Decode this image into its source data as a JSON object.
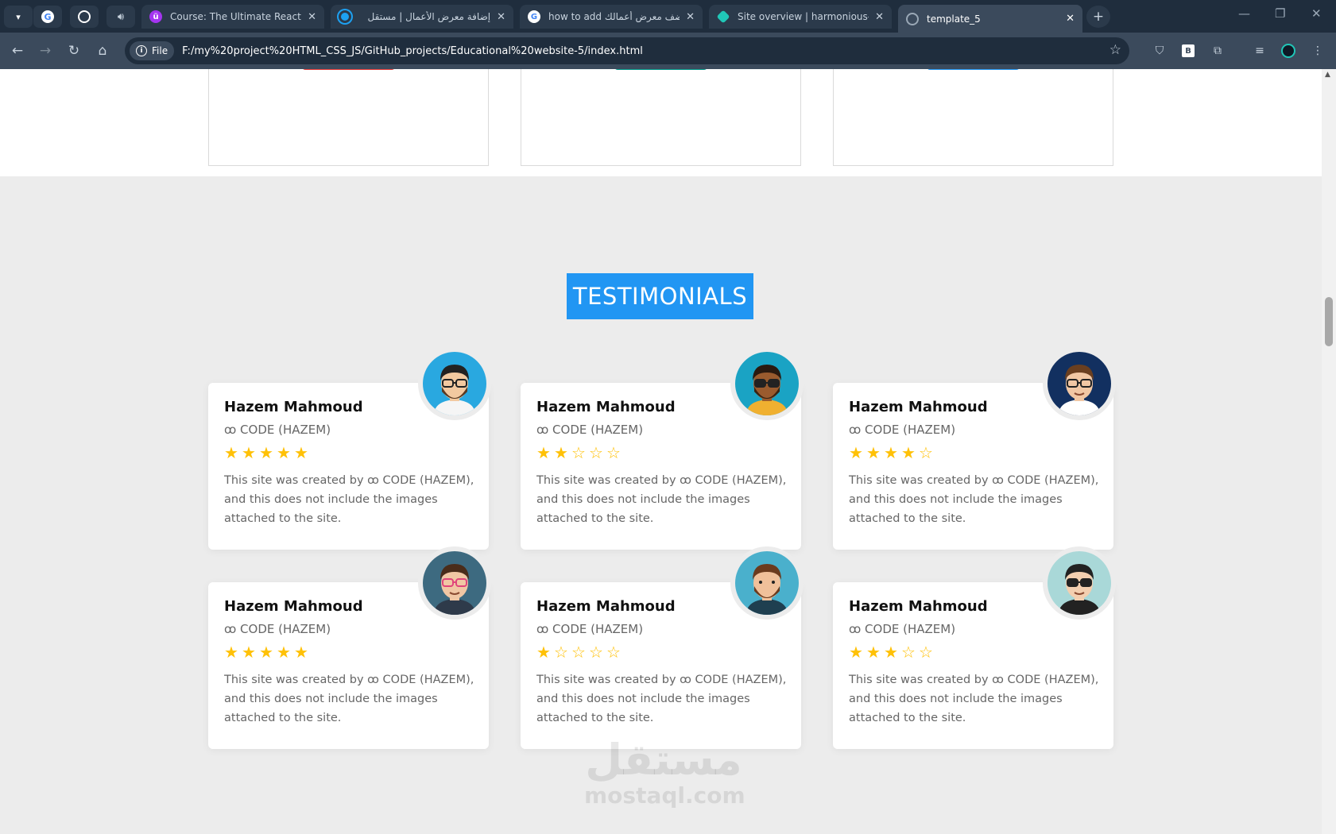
{
  "browser": {
    "tabs": [
      {
        "title": "Course: The Ultimate React Cou",
        "favicon": "udemy-icon",
        "favicon_color": "#a435f0"
      },
      {
        "title": "إضافة معرض الأعمال | مستقل",
        "favicon": "mostaql-icon",
        "favicon_color": "#1da1f2"
      },
      {
        "title": "how to add اضف معرض أعمالك",
        "favicon": "google-icon",
        "favicon_color": "#ffffff"
      },
      {
        "title": "Site overview | harmonious-gec",
        "favicon": "netlify-icon",
        "favicon_color": "#20c6b7"
      },
      {
        "title": "template_5",
        "favicon": "globe-icon",
        "favicon_color": "#9aa8b6",
        "active": true
      }
    ],
    "address": {
      "scheme_label": "File",
      "url": "F:/my%20project%20HTML_CSS_JS/GitHub_projects/Educational%20website-5/index.html"
    }
  },
  "page": {
    "section_title": "TESTIMONIALS",
    "top_card_button_colors": [
      "#e53935",
      "#009688",
      "#2196f3"
    ],
    "testimonials": [
      {
        "name": "Hazem Mahmoud",
        "role": "ꝏ CODE (HAZEM)",
        "rating": 5,
        "text": "This site was created by ꝏ CODE (HAZEM), and this does not include the images attached to the site.",
        "avatar": "avatar-beard-glasses-icon"
      },
      {
        "name": "Hazem Mahmoud",
        "role": "ꝏ CODE (HAZEM)",
        "rating": 2,
        "text": "This site was created by ꝏ CODE (HAZEM), and this does not include the images attached to the site.",
        "avatar": "avatar-sunglasses-icon"
      },
      {
        "name": "Hazem Mahmoud",
        "role": "ꝏ CODE (HAZEM)",
        "rating": 4,
        "text": "This site was created by ꝏ CODE (HAZEM), and this does not include the images attached to the site.",
        "avatar": "avatar-glasses-icon"
      },
      {
        "name": "Hazem Mahmoud",
        "role": "ꝏ CODE (HAZEM)",
        "rating": 5,
        "text": "This site was created by ꝏ CODE (HAZEM), and this does not include the images attached to the site.",
        "avatar": "avatar-pink-glasses-icon"
      },
      {
        "name": "Hazem Mahmoud",
        "role": "ꝏ CODE (HAZEM)",
        "rating": 1,
        "text": "This site was created by ꝏ CODE (HAZEM), and this does not include the images attached to the site.",
        "avatar": "avatar-bearded-icon"
      },
      {
        "name": "Hazem Mahmoud",
        "role": "ꝏ CODE (HAZEM)",
        "rating": 3,
        "text": "This site was created by ꝏ CODE (HAZEM), and this does not include the images attached to the site.",
        "avatar": "avatar-dark-glasses-icon"
      }
    ],
    "watermark": {
      "arabic": "مستقل",
      "latin": "mostaql.com"
    }
  }
}
